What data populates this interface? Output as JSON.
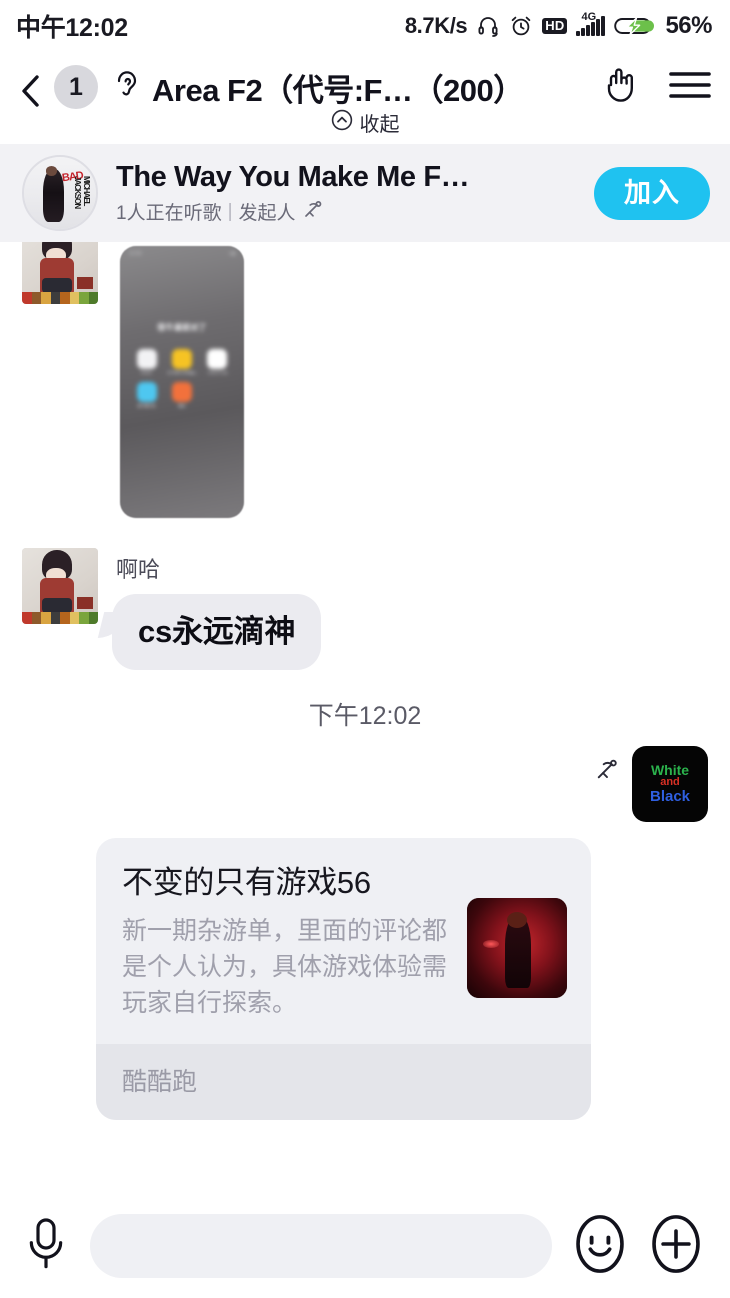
{
  "statusbar": {
    "time": "中午12:02",
    "network_speed": "8.7K/s",
    "icons": [
      "headset-icon",
      "alarm-clock-icon",
      "hd-icon",
      "signal-4g-icon",
      "battery-charging-icon"
    ],
    "hd_label": "HD",
    "network_type": "4G",
    "battery_percent": "56%"
  },
  "header": {
    "back_icon": "chevron-left-icon",
    "unread_count": "1",
    "ear_icon": "ear-icon",
    "title": "Area F2（代号:F…（200）",
    "rock_hand_icon": "rock-hand-icon",
    "menu_icon": "hamburger-menu-icon",
    "collapse_label": "收起",
    "collapse_icon": "chevron-up-circle-icon"
  },
  "music_banner": {
    "album_art": "michael-jackson-bad-album-cover",
    "album_art_text_bad": "BAD",
    "album_art_text_artist": "MICHAEL JACKSON",
    "title": "The Way You Make Me F…",
    "listeners": "1人正在听歌",
    "separator": "|",
    "initiator": "发起人",
    "initiator_icon": "hammer-sickle-icon",
    "join_label": "加入",
    "accent_color": "#1fc2f0"
  },
  "chat": {
    "shared_image_message": {
      "avatar": "anime-girl-pixel-art-avatar",
      "image_type": "phone-home-screen-screenshot",
      "shot_title": "很牛逼就对了",
      "shot_status_left": "12:50",
      "shot_apps": [
        {
          "label": "Roblox",
          "color": "#f2f2f4"
        },
        {
          "label": "元气符号-符号输入",
          "color": "#f6c324"
        },
        {
          "label": "CRAZYCraft",
          "color": "#ffffff"
        },
        {
          "label": "星节奏手游",
          "color": "#4ec7f0"
        },
        {
          "label": "酷安",
          "color": "#f2713c"
        }
      ]
    },
    "text_message": {
      "avatar": "anime-girl-pixel-art-avatar",
      "sender": "啊哈",
      "text": "cs永远滴神"
    },
    "time_divider": "下午12:02",
    "outgoing_message": {
      "badge_icon": "hammer-sickle-icon",
      "avatar": "white-and-black-avatar",
      "avatar_line1": "White",
      "avatar_line2": "and",
      "avatar_line3": "Black",
      "avatar_line1_color": "#2bb24c",
      "avatar_line2_color": "#d93025",
      "avatar_line3_color": "#2f5fe0",
      "card": {
        "title": "不变的只有游戏56",
        "description": "新一期杂游单，里面的评论都是个人认为，具体游戏体验需玩家自行探索。",
        "thumbnail": "scarlet-witch-red-artwork",
        "source": "酷酷跑"
      }
    }
  },
  "inputbar": {
    "mic_icon": "microphone-icon",
    "composer_placeholder": "",
    "composer_value": "",
    "emoji_icon": "smiley-face-icon",
    "add_icon": "plus-circle-icon"
  }
}
